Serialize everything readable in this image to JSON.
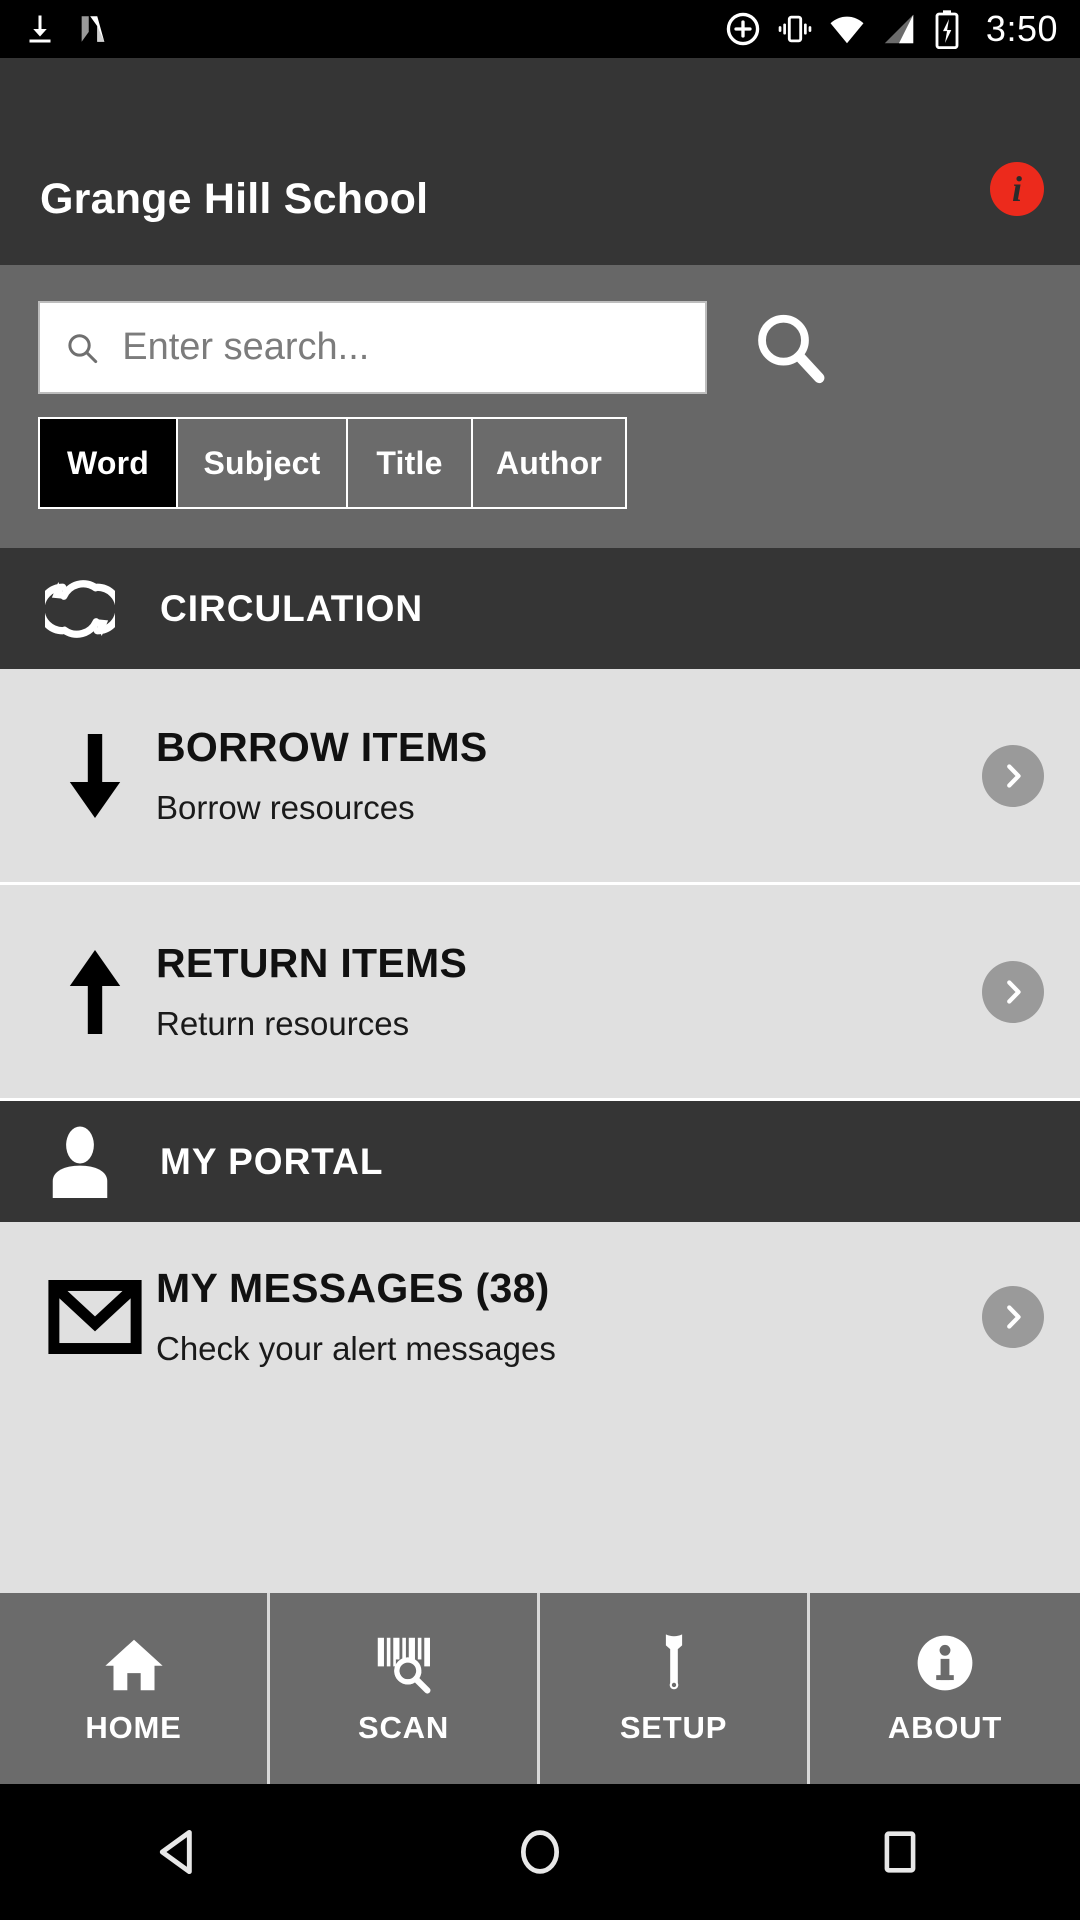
{
  "status_bar": {
    "time": "3:50",
    "left_icons": [
      "download-icon",
      "nougat-n-icon"
    ],
    "right_icons": [
      "add-circle-icon",
      "vibrate-icon",
      "wifi-icon",
      "cell-signal-icon",
      "battery-charging-icon"
    ]
  },
  "app_bar": {
    "title": "Grange Hill School",
    "info_icon_label": "i",
    "info_icon_color": "#ec2a1c"
  },
  "search": {
    "placeholder": "Enter search...",
    "value": "",
    "submit_icon": "search-icon",
    "tabs": [
      {
        "label": "Word",
        "selected": true
      },
      {
        "label": "Subject",
        "selected": false
      },
      {
        "label": "Title",
        "selected": false
      },
      {
        "label": "Author",
        "selected": false
      }
    ]
  },
  "sections": [
    {
      "header": {
        "label": "CIRCULATION",
        "icon": "sync-arrows-icon"
      },
      "rows": [
        {
          "title": "BORROW ITEMS",
          "subtitle": "Borrow resources",
          "icon": "arrow-down-icon",
          "chevron": "chevron-right-icon"
        },
        {
          "title": "RETURN ITEMS",
          "subtitle": "Return resources",
          "icon": "arrow-up-icon",
          "chevron": "chevron-right-icon"
        }
      ]
    },
    {
      "header": {
        "label": "MY PORTAL",
        "icon": "person-icon"
      },
      "rows": [
        {
          "title": "MY MESSAGES (38)",
          "subtitle": "Check your alert messages",
          "icon": "envelope-icon",
          "chevron": "chevron-right-icon"
        }
      ]
    }
  ],
  "bottom_nav": [
    {
      "label": "HOME",
      "icon": "home-icon"
    },
    {
      "label": "SCAN",
      "icon": "barcode-scan-icon"
    },
    {
      "label": "SETUP",
      "icon": "wrench-icon"
    },
    {
      "label": "ABOUT",
      "icon": "info-circle-icon"
    }
  ],
  "android_nav": [
    {
      "name": "back-button",
      "icon": "triangle-back-icon"
    },
    {
      "name": "home-button",
      "icon": "circle-home-icon"
    },
    {
      "name": "recents-button",
      "icon": "square-recents-icon"
    }
  ],
  "colors": {
    "app_bar": "#353535",
    "search_bg": "#676767",
    "section_header": "#353535",
    "row_bg": "#e0e0e0",
    "nav_bg": "#6b6b6b",
    "accent_red": "#ec2a1c"
  }
}
